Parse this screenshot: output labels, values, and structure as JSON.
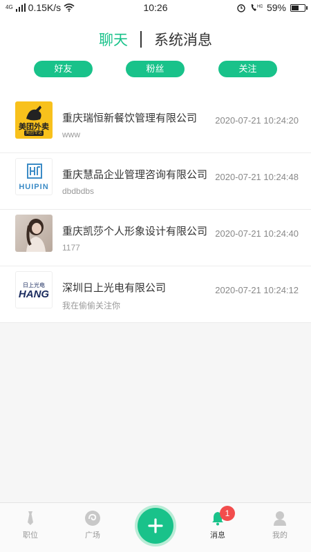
{
  "status_bar": {
    "network_speed": "0.15K/s",
    "signal_label": "4G",
    "time": "10:26",
    "battery": "59%",
    "battery_level": 0.59
  },
  "header": {
    "tabs": [
      {
        "label": "聊天",
        "active": true
      },
      {
        "label": "系统消息",
        "active": false
      }
    ],
    "filters": [
      "好友",
      "粉丝",
      "关注"
    ]
  },
  "messages": [
    {
      "company": "重庆瑞恒新餐饮管理有限公司",
      "preview": "www",
      "time": "2020-07-21 10:24:20",
      "avatar": "meituan-logo",
      "logo_text": "美团外卖",
      "logo_sub": "美团专送"
    },
    {
      "company": "重庆慧品企业管理咨询有限公司",
      "preview": "dbdbdbs",
      "time": "2020-07-21 10:24:48",
      "avatar": "huipin-logo",
      "logo_text": "HUIPIN"
    },
    {
      "company": "重庆凯莎个人形象设计有限公司",
      "preview": "1177",
      "time": "2020-07-21 10:24:40",
      "avatar": "portrait-photo"
    },
    {
      "company": "深圳日上光电有限公司",
      "preview": "我在偷偷关注你",
      "time": "2020-07-21 10:24:12",
      "avatar": "hang-logo",
      "logo_text": "HANG",
      "logo_sub": "日上光电"
    }
  ],
  "tabbar": {
    "items": [
      {
        "label": "职位",
        "icon": "tie-icon"
      },
      {
        "label": "广场",
        "icon": "swirl-icon"
      },
      {
        "label": "消息",
        "icon": "bell-icon",
        "badge": "1",
        "active": true
      },
      {
        "label": "我的",
        "icon": "person-icon"
      }
    ],
    "fab_icon": "plus-icon"
  },
  "colors": {
    "accent": "#19c28a",
    "badge": "#f24d4d"
  }
}
